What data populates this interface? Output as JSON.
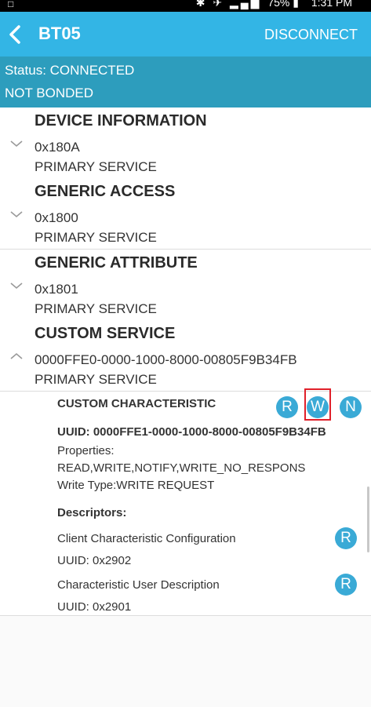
{
  "status_bar": {
    "left_text": "□",
    "battery": "75%",
    "time": "1:31 PM"
  },
  "app_bar": {
    "title": "BT05",
    "action": "DISCONNECT"
  },
  "status_panel": {
    "connection": "Status: CONNECTED",
    "bond": "NOT BONDED"
  },
  "services": [
    {
      "name": "DEVICE INFORMATION",
      "uuid": "0x180A",
      "type": "PRIMARY SERVICE",
      "expanded": false
    },
    {
      "name": "GENERIC ACCESS",
      "uuid": "0x1800",
      "type": "PRIMARY SERVICE",
      "expanded": false
    },
    {
      "name": "GENERIC ATTRIBUTE",
      "uuid": "0x1801",
      "type": "PRIMARY SERVICE",
      "expanded": false
    },
    {
      "name": "CUSTOM SERVICE",
      "uuid": "0000FFE0-0000-1000-8000-00805F9B34FB",
      "type": "PRIMARY SERVICE",
      "expanded": true
    }
  ],
  "characteristic": {
    "name": "CUSTOM CHARACTERISTIC",
    "uuid": "UUID: 0000FFE1-0000-1000-8000-00805F9B34FB",
    "properties_label": "Properties:",
    "properties_value": "READ,WRITE,NOTIFY,WRITE_NO_RESPONS",
    "write_type": "Write Type:WRITE REQUEST",
    "buttons": {
      "read": "R",
      "write": "W",
      "notify": "N"
    },
    "descriptors_label": "Descriptors:",
    "descriptors": [
      {
        "name": "Client Characteristic Configuration",
        "uuid": "UUID: 0x2902",
        "button": "R"
      },
      {
        "name": "Characteristic User Description",
        "uuid": "UUID: 0x2901",
        "button": "R"
      }
    ]
  },
  "colors": {
    "app_bar": "#33b5e5",
    "status_panel": "#2d9dbd",
    "button": "#3aaad6",
    "highlight": "#e0202a"
  }
}
